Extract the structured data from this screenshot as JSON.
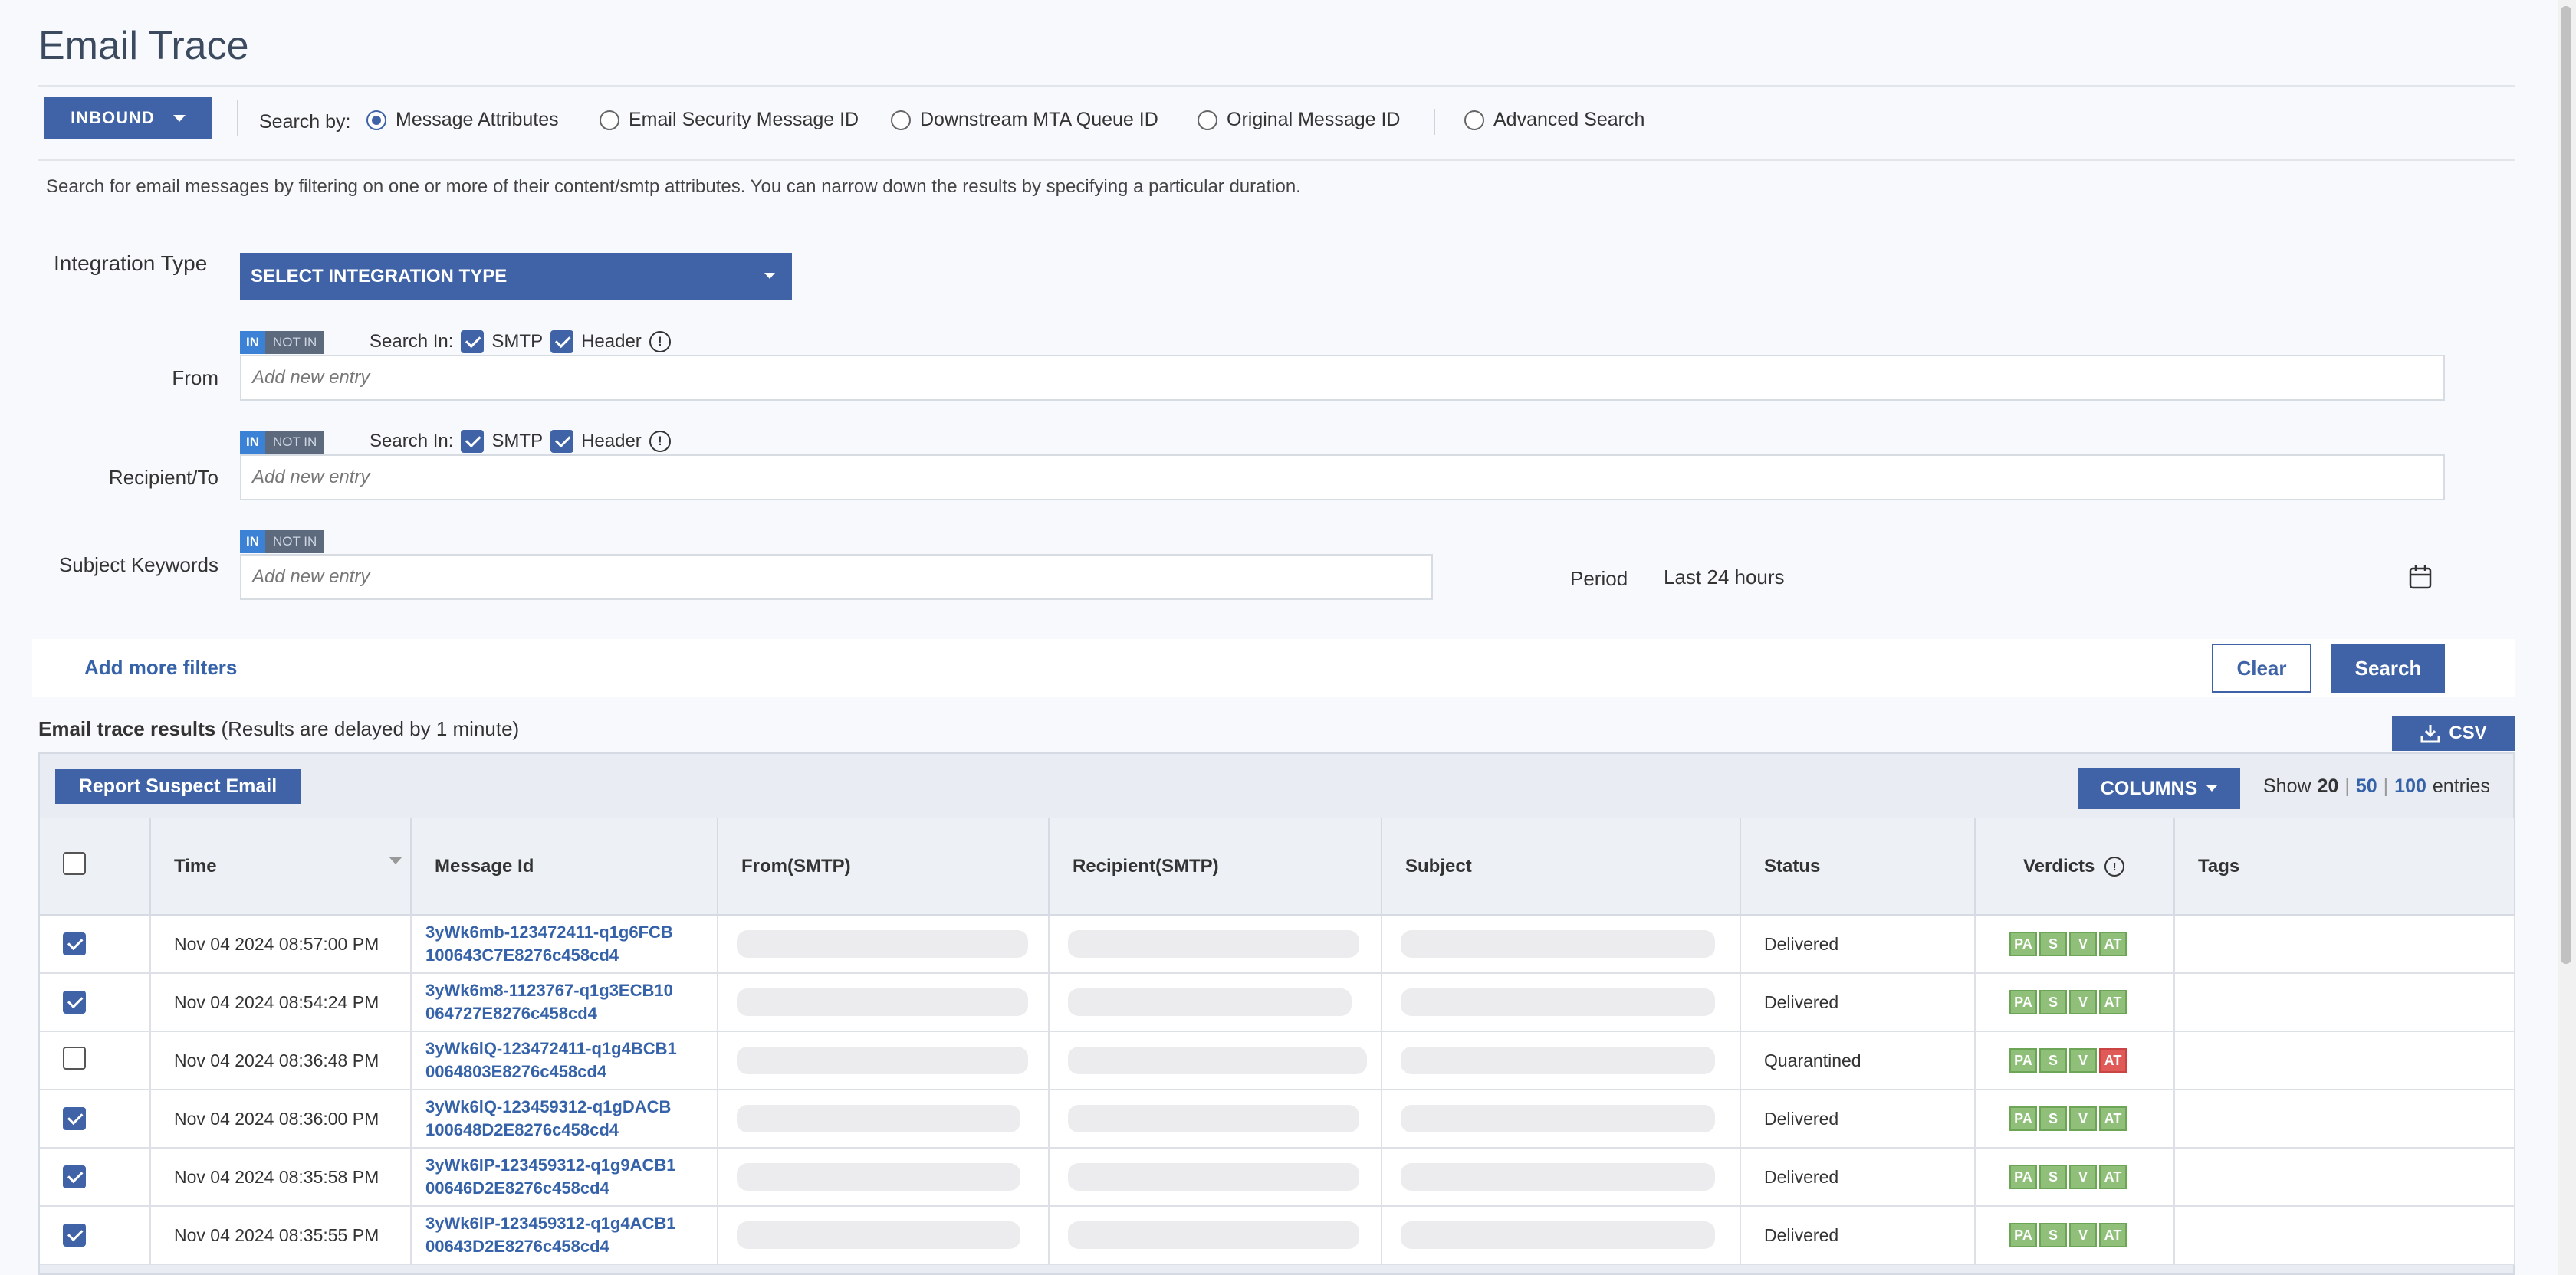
{
  "page": {
    "title": "Email Trace"
  },
  "top": {
    "direction_button": "INBOUND",
    "search_by_label": "Search by:",
    "options": [
      "Message Attributes",
      "Email Security Message ID",
      "Downstream MTA Queue ID",
      "Original Message ID"
    ],
    "advanced": "Advanced Search",
    "selected_option": "Message Attributes"
  },
  "description": "Search for email messages by filtering on one or more of their content/smtp attributes. You can narrow down the results by specifying a particular duration.",
  "filters": {
    "integration_label": "Integration Type",
    "integration_select": "SELECT INTEGRATION TYPE",
    "toggle_in": "IN",
    "toggle_not_in": "NOT IN",
    "search_in_label": "Search In:",
    "smtp_label": "SMTP",
    "header_label": "Header",
    "from_label": "From",
    "recipient_label": "Recipient/To",
    "subject_label": "Subject Keywords",
    "placeholder": "Add new entry",
    "period_label": "Period",
    "period_value": "Last 24 hours",
    "add_more": "Add more filters",
    "clear": "Clear",
    "search": "Search"
  },
  "results": {
    "title": "Email trace results",
    "note": "(Results are delayed by 1 minute)",
    "csv": "CSV",
    "report": "Report Suspect Email",
    "columns": "COLUMNS",
    "show_label": "Show",
    "show_20": "20",
    "show_50": "50",
    "show_100": "100",
    "entries": "entries",
    "sep": "|",
    "headers": [
      "Time",
      "Message Id",
      "From(SMTP)",
      "Recipient(SMTP)",
      "Subject",
      "Status",
      "Verdicts",
      "Tags"
    ],
    "verdict_labels": [
      "PA",
      "S",
      "V",
      "AT"
    ],
    "rows": [
      {
        "checked": true,
        "time": "Nov 04 2024 08:57:00 PM",
        "id1": "3yWk6mb-123472411-q1g6FCB",
        "id2": "100643C7E8276c458cd4",
        "status": "Delivered",
        "at_red": false
      },
      {
        "checked": true,
        "time": "Nov 04 2024 08:54:24 PM",
        "id1": "3yWk6m8-1123767-q1g3ECB10",
        "id2": "064727E8276c458cd4",
        "status": "Delivered",
        "at_red": false
      },
      {
        "checked": false,
        "time": "Nov 04 2024 08:36:48 PM",
        "id1": "3yWk6lQ-123472411-q1g4BCB1",
        "id2": "0064803E8276c458cd4",
        "status": "Quarantined",
        "at_red": true
      },
      {
        "checked": true,
        "time": "Nov 04 2024 08:36:00 PM",
        "id1": "3yWk6lQ-123459312-q1gDACB",
        "id2": "100648D2E8276c458cd4",
        "status": "Delivered",
        "at_red": false
      },
      {
        "checked": true,
        "time": "Nov 04 2024 08:35:58 PM",
        "id1": "3yWk6lP-123459312-q1g9ACB1",
        "id2": "00646D2E8276c458cd4",
        "status": "Delivered",
        "at_red": false
      },
      {
        "checked": true,
        "time": "Nov 04 2024 08:35:55 PM",
        "id1": "3yWk6lP-123459312-q1g4ACB1",
        "id2": "00643D2E8276c458cd4",
        "status": "Delivered",
        "at_red": false
      }
    ]
  },
  "colors": {
    "primary": "#3f63a6",
    "link": "#3562a8",
    "verdict_green": "#8fbf79",
    "verdict_red": "#e05a57"
  }
}
